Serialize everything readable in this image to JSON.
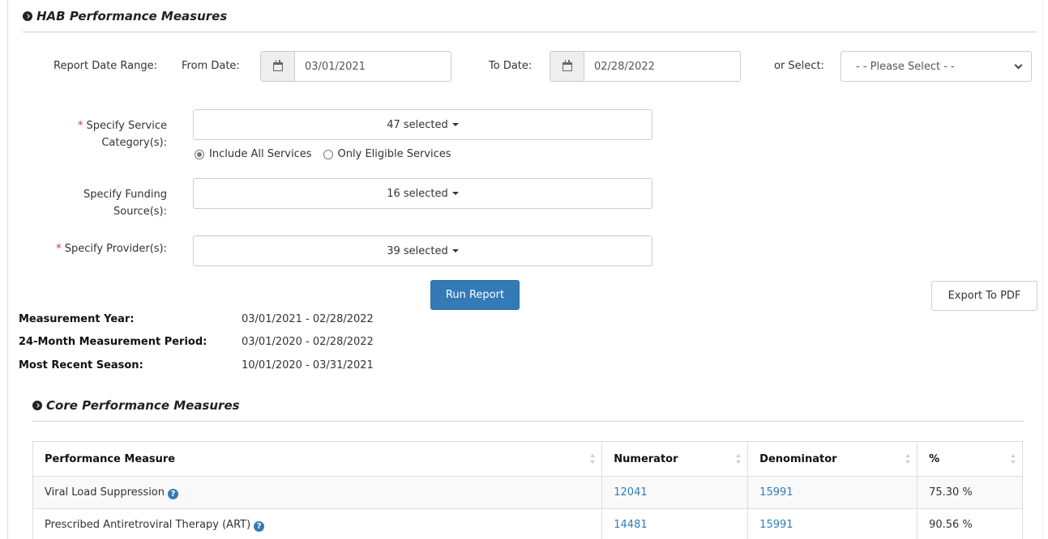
{
  "header": {
    "title": "HAB Performance Measures"
  },
  "date_range": {
    "label": "Report Date Range:",
    "from_label": "From Date:",
    "from_value": "03/01/2021",
    "to_label": "To Date:",
    "to_value": "02/28/2022",
    "or_select_label": "or Select:",
    "select_value": "- - Please Select - -"
  },
  "filters": {
    "service_category_label_line1": "Specify Service",
    "service_category_label_line2": "Category(s):",
    "service_category_value": "47 selected",
    "radio_all": "Include All Services",
    "radio_eligible": "Only Eligible Services",
    "funding_label_line1": "Specify Funding",
    "funding_label_line2": "Source(s):",
    "funding_value": "16 selected",
    "provider_label": "Specify Provider(s):",
    "provider_value": "39 selected",
    "required_marker": "*"
  },
  "actions": {
    "run_report": "Run Report",
    "export_pdf": "Export To PDF"
  },
  "info": {
    "measurement_year_label": "Measurement Year:",
    "measurement_year_value": "03/01/2021 - 02/28/2022",
    "period_label": "24-Month Measurement Period:",
    "period_value": "03/01/2020 - 02/28/2022",
    "season_label": "Most Recent Season:",
    "season_value": "10/01/2020 - 03/31/2021"
  },
  "core": {
    "title": "Core Performance Measures",
    "columns": [
      "Performance Measure",
      "Numerator",
      "Denominator",
      "%"
    ],
    "rows": [
      {
        "measure": "Viral Load Suppression",
        "numerator": "12041",
        "denominator": "15991",
        "percent": "75.30 %"
      },
      {
        "measure": "Prescribed Antiretroviral Therapy (ART)",
        "numerator": "14481",
        "denominator": "15991",
        "percent": "90.56 %"
      }
    ],
    "help_glyph": "?"
  },
  "colors": {
    "primary": "#337ab7",
    "required": "#d9302c",
    "link": "#337ab7"
  }
}
